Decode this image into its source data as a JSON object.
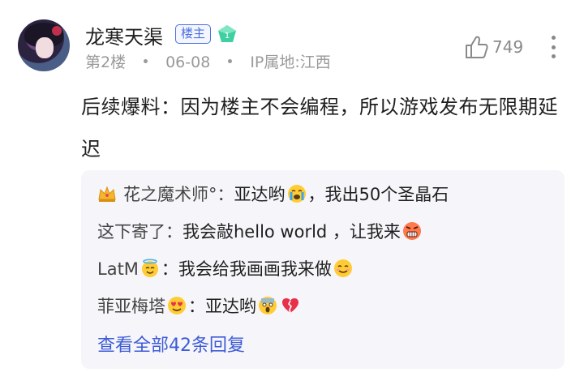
{
  "post": {
    "username": "龙寒天渠",
    "owner_badge": "楼主",
    "level_badge": "1",
    "floor": "第2楼",
    "date": "06-08",
    "ip_location": "IP属地:江西",
    "like_count": "749",
    "content": "后续爆料：因为楼主不会编程，所以游戏发布无限期延迟"
  },
  "replies": [
    {
      "author": "花之魔术师°：",
      "text_before": "亚达哟",
      "text_after": "，我出50个圣晶石"
    },
    {
      "author": "这下寄了：",
      "text_before": "我会敲hello world ，让我来",
      "text_after": ""
    },
    {
      "author": "LatM",
      "text_before": "：我会给我画画我来做",
      "text_after": ""
    },
    {
      "author": "菲亚梅塔",
      "text_before": "：亚达哟",
      "text_after": ""
    }
  ],
  "view_all": "查看全部42条回复",
  "colors": {
    "accent": "#4c6fe0",
    "link": "#3e5bd6",
    "level_badge": "#3fcfa0",
    "reply_bg": "#f6f6fa"
  }
}
